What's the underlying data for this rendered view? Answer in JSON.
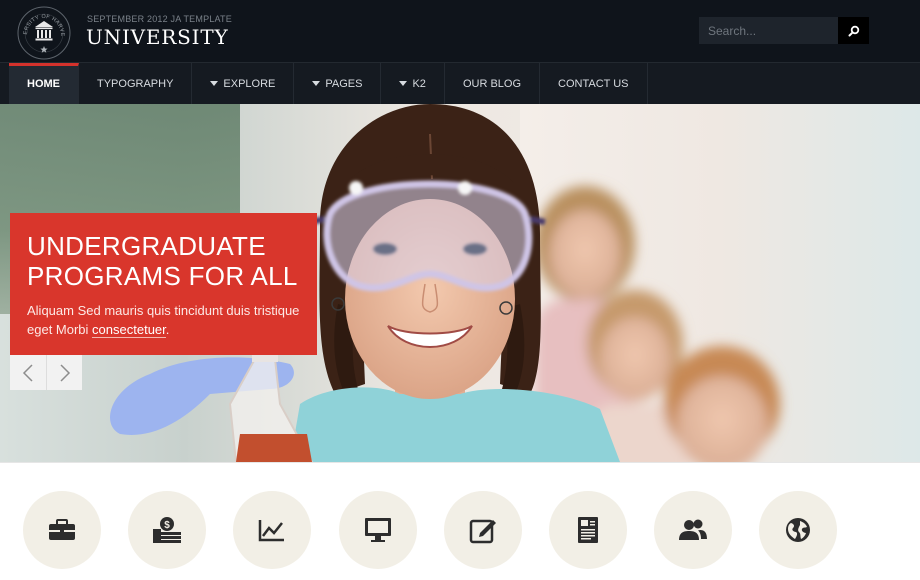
{
  "brand": {
    "tagline": "SEPTEMBER 2012 JA TEMPLATE",
    "title": "UNIVERSITY",
    "seal_text": "UNIVERSITY OF HARVERDE"
  },
  "search": {
    "placeholder": "Search..."
  },
  "nav": {
    "items": [
      {
        "label": "HOME",
        "active": true,
        "dropdown": false
      },
      {
        "label": "TYPOGRAPHY",
        "active": false,
        "dropdown": false
      },
      {
        "label": "EXPLORE",
        "active": false,
        "dropdown": true
      },
      {
        "label": "PAGES",
        "active": false,
        "dropdown": true
      },
      {
        "label": "K2",
        "active": false,
        "dropdown": true
      },
      {
        "label": "OUR BLOG",
        "active": false,
        "dropdown": false
      },
      {
        "label": "CONTACT US",
        "active": false,
        "dropdown": false
      }
    ]
  },
  "hero": {
    "title_line1": "UNDERGRADUATE",
    "title_line2": "PROGRAMS FOR ALL",
    "text_before_link": "Aliquam Sed mauris quis tincidunt duis tristique eget Morbi ",
    "link_text": "consectetuer",
    "text_after_link": "."
  },
  "features": [
    {
      "icon": "briefcase-icon"
    },
    {
      "icon": "money-icon"
    },
    {
      "icon": "chart-icon"
    },
    {
      "icon": "monitor-icon"
    },
    {
      "icon": "edit-icon"
    },
    {
      "icon": "document-icon"
    },
    {
      "icon": "users-icon"
    },
    {
      "icon": "globe-icon"
    }
  ],
  "colors": {
    "header_bg": "#0f141b",
    "nav_bg": "#151a21",
    "accent": "#d9362c",
    "feature_circle": "#f2efe6",
    "icon_color": "#2d2d2d"
  }
}
